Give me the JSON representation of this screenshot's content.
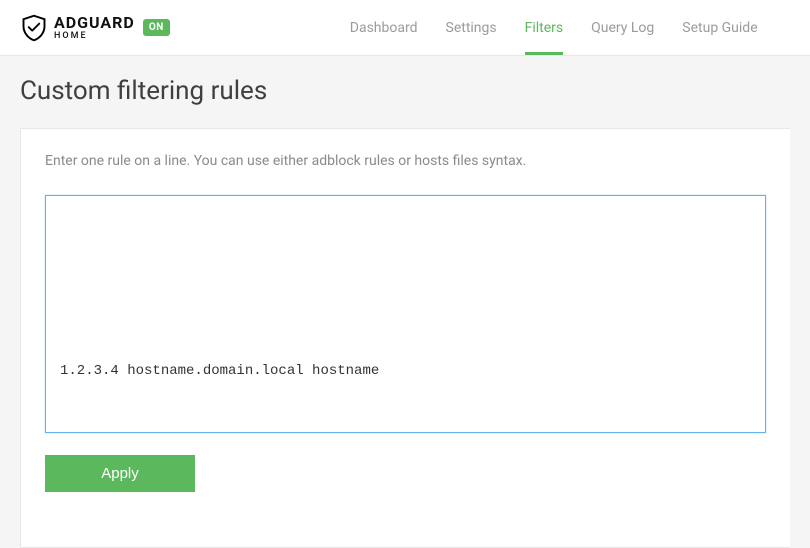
{
  "header": {
    "brand_main": "ADGUARD",
    "brand_sub": "HOME",
    "status": "ON",
    "nav": {
      "dashboard": "Dashboard",
      "settings": "Settings",
      "filters": "Filters",
      "query_log": "Query Log",
      "setup_guide": "Setup Guide"
    }
  },
  "page": {
    "title": "Custom filtering rules",
    "instructions": "Enter one rule on a line. You can use either adblock rules or hosts files syntax.",
    "rules_value": "1.2.3.4 hostname.domain.local hostname",
    "apply_label": "Apply"
  }
}
